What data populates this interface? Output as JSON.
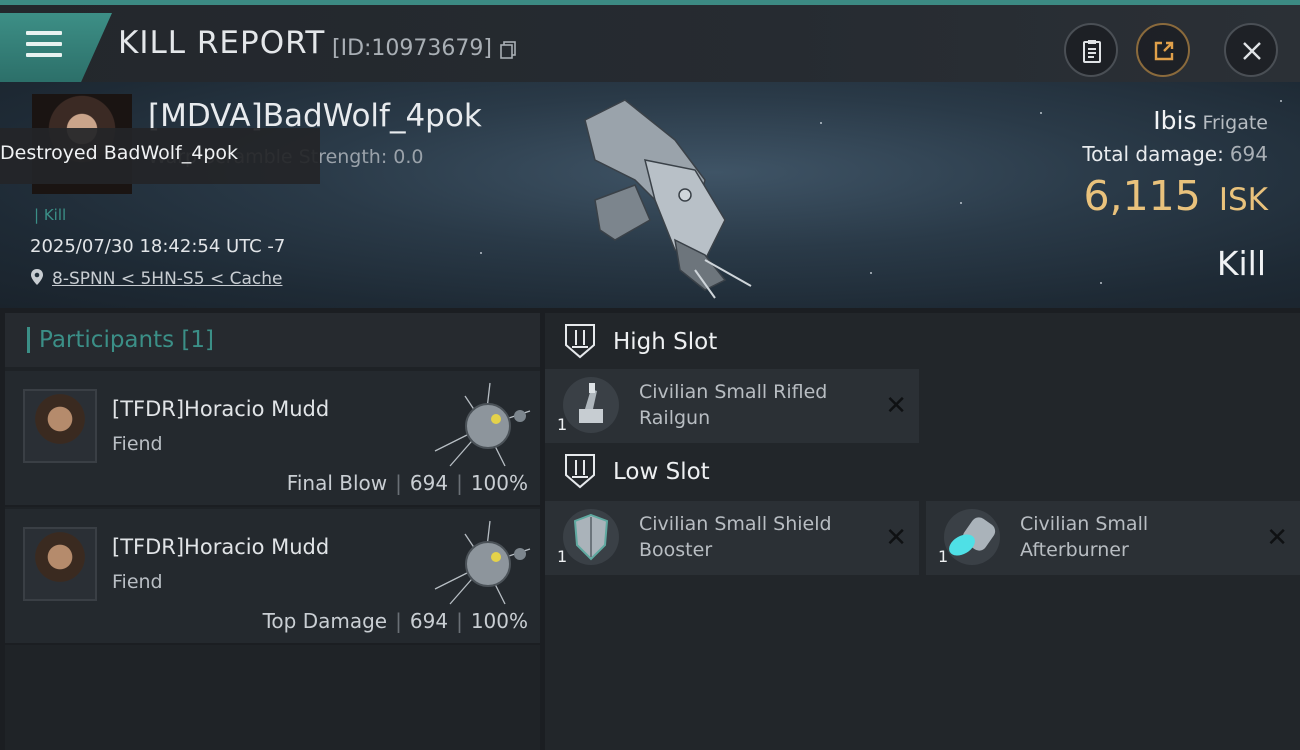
{
  "header": {
    "title": "KILL REPORT",
    "report_id": "[ID:10973679]"
  },
  "victim": {
    "name": "[MDVA]BadWolf_4pok",
    "tooltip": "Destroyed BadWolf_4pok",
    "scramble": "Warp Scramble Strength: 0.0",
    "kill_tag": "Kill",
    "timestamp": "2025/07/30 18:42:54 UTC -7",
    "location": "8-SPNN < 5HN-S5 < Cache",
    "ship_name": "Ibis",
    "ship_class": "Frigate",
    "total_damage_label": "Total damage:",
    "total_damage": "694",
    "isk_value": "6,115",
    "isk_unit": "ISK",
    "result": "Kill"
  },
  "participants": {
    "title": "Participants [1]",
    "items": [
      {
        "name": "[TFDR]Horacio Mudd",
        "corp": "Fiend",
        "role": "Final Blow",
        "damage": "694",
        "percent": "100%"
      },
      {
        "name": "[TFDR]Horacio Mudd",
        "corp": "Fiend",
        "role": "Top Damage",
        "damage": "694",
        "percent": "100%"
      }
    ]
  },
  "fittings": {
    "high_slot": {
      "title": "High Slot",
      "modules": [
        {
          "name": "Civilian Small Rifled Railgun",
          "qty": "1",
          "icon": "railgun-icon"
        }
      ]
    },
    "low_slot": {
      "title": "Low Slot",
      "modules": [
        {
          "name": "Civilian Small Shield Booster",
          "qty": "1",
          "icon": "shield-booster-icon"
        },
        {
          "name": "Civilian Small Afterburner",
          "qty": "1",
          "icon": "afterburner-icon"
        }
      ]
    },
    "close_glyph": "✕"
  },
  "colors": {
    "accent": "#3b8f87",
    "isk": "#e9c27c",
    "share": "#c48a3a"
  }
}
